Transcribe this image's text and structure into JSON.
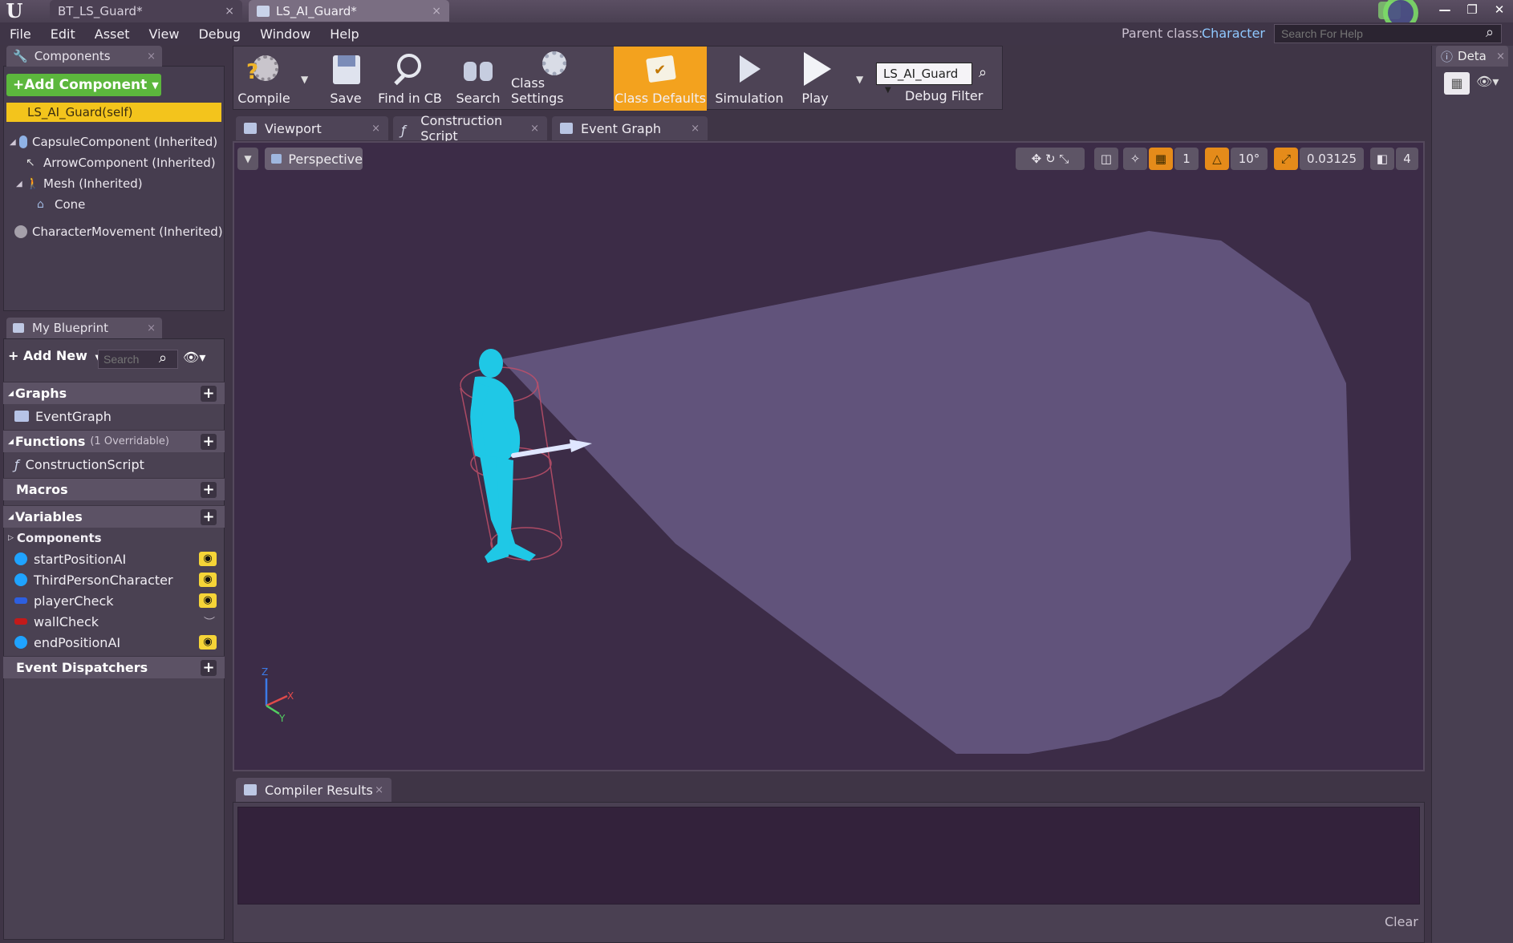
{
  "window": {
    "tabs": [
      {
        "label": "BT_LS_Guard*"
      },
      {
        "label": "LS_AI_Guard*"
      }
    ],
    "controls": {
      "minimize": "—",
      "restore": "❐",
      "close": "✕"
    }
  },
  "menu": {
    "items": [
      "File",
      "Edit",
      "Asset",
      "View",
      "Debug",
      "Window",
      "Help"
    ],
    "parent_class_label": "Parent class:",
    "parent_class_value": "Character",
    "help_search_placeholder": "Search For Help"
  },
  "components": {
    "tab_label": "Components",
    "add_button": "+Add Component",
    "self_item": "LS_AI_Guard(self)",
    "tree": [
      {
        "label": "CapsuleComponent (Inherited)",
        "icon": "capsule-icon"
      },
      {
        "label": "ArrowComponent (Inherited)",
        "icon": "arrow-icon"
      },
      {
        "label": "Mesh (Inherited)",
        "icon": "mesh-icon"
      },
      {
        "label": "Cone",
        "icon": "cone-icon"
      },
      {
        "label": "CharacterMovement (Inherited)",
        "icon": "movement-icon"
      }
    ]
  },
  "my_blueprint": {
    "tab_label": "My Blueprint",
    "add_new": "+ Add New",
    "search_placeholder": "Search",
    "sections": {
      "graphs": "Graphs",
      "functions": "Functions",
      "functions_note": "(1 Overridable)",
      "macros": "Macros",
      "variables": "Variables",
      "event_dispatchers": "Event Dispatchers"
    },
    "graph_items": [
      "EventGraph"
    ],
    "function_items": [
      "ConstructionScript"
    ],
    "components_group": "Components",
    "variables": [
      {
        "name": "startPositionAI",
        "color": "#1fa3ff",
        "visible": true
      },
      {
        "name": "ThirdPersonCharacter",
        "color": "#1fa3ff",
        "visible": true
      },
      {
        "name": "playerCheck",
        "color": "#2d5fe0",
        "visible": true
      },
      {
        "name": "wallCheck",
        "color": "#c31a1a",
        "visible": false
      },
      {
        "name": "endPositionAI",
        "color": "#1fa3ff",
        "visible": true
      }
    ]
  },
  "toolbar": {
    "compile": "Compile",
    "save": "Save",
    "find_in_cb": "Find in CB",
    "search": "Search",
    "class_settings": "Class Settings",
    "class_defaults": "Class Defaults",
    "simulation": "Simulation",
    "play": "Play",
    "debug_filter_value": "LS_AI_Guard",
    "debug_filter_label": "Debug Filter"
  },
  "editor_tabs": [
    {
      "label": "Viewport"
    },
    {
      "label": "Construction Script"
    },
    {
      "label": "Event Graph"
    }
  ],
  "viewport": {
    "view_mode": "Perspective",
    "rotation_snap": "10°",
    "grid_size": "1",
    "scale_snap": "0.03125",
    "camera_speed": "4"
  },
  "compiler": {
    "tab_label": "Compiler Results",
    "clear": "Clear"
  },
  "details": {
    "tab_label": "Deta"
  },
  "colors": {
    "accent_orange": "#f3a21e",
    "add_green": "#5cb73d",
    "self_yellow": "#f3c41c",
    "character_cyan": "#1fc8e6",
    "cone_fill": "#63557e",
    "parent_class_blue": "#8fc8ff"
  }
}
